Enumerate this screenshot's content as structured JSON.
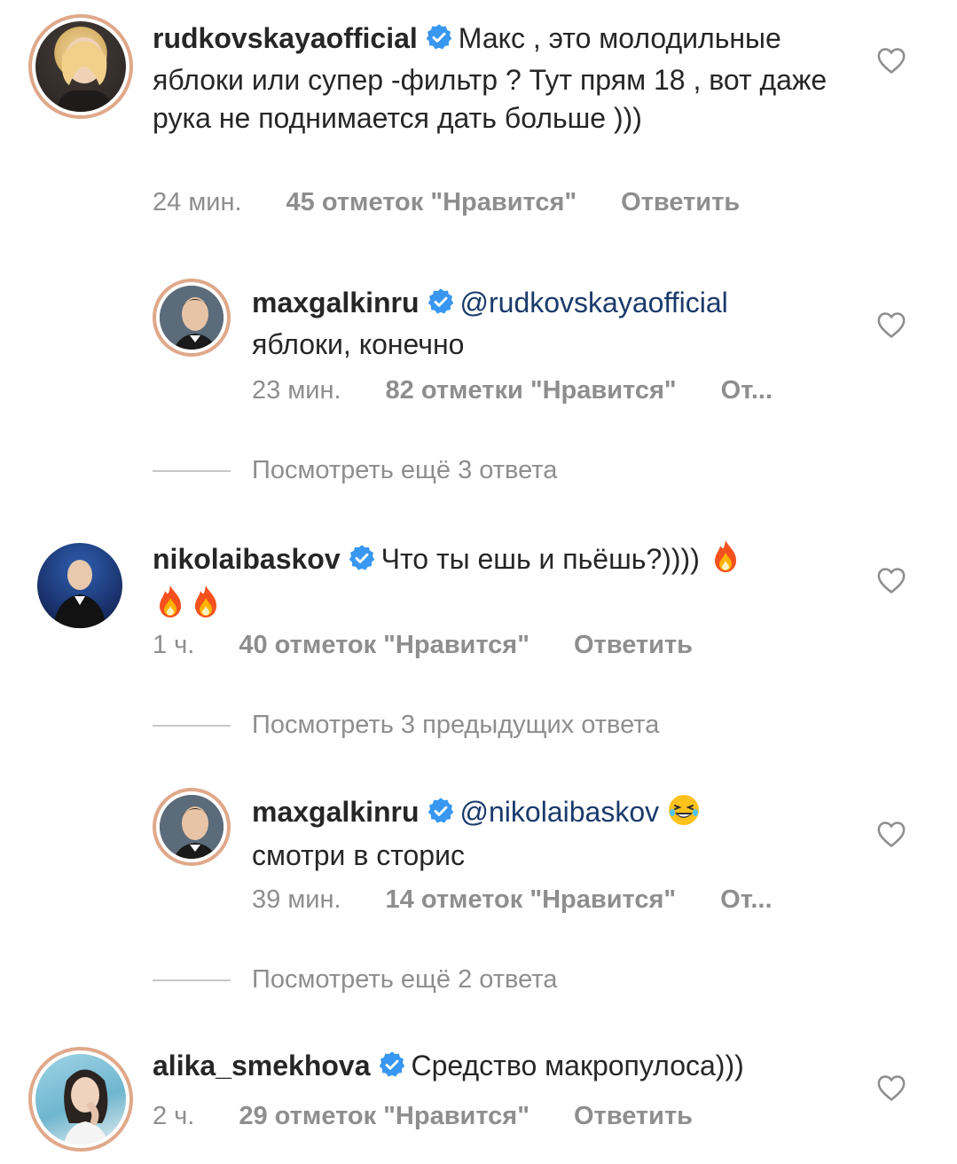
{
  "comments": [
    {
      "username": "rudkovskayaofficial",
      "text": "Макс , это молодильные яблоки или супер -фильтр ? Тут прям 18 , вот даже рука не поднимается дать больше )))",
      "time": "24 мин.",
      "likes": "45 отметок \"Нравится\"",
      "reply": "Ответить"
    },
    {
      "username": "maxgalkinru",
      "mention": "@rudkovskayaofficial",
      "text": "яблоки, конечно",
      "time": "23 мин.",
      "likes": "82 отметки \"Нравится\"",
      "reply": "От..."
    },
    {
      "username": "nikolaibaskov",
      "text": "Что ты ешь и пьёшь?))))",
      "time": "1 ч.",
      "likes": "40 отметок \"Нравится\"",
      "reply": "Ответить"
    },
    {
      "username": "maxgalkinru",
      "mention": "@nikolaibaskov",
      "text": "смотри в сторис",
      "time": "39 мин.",
      "likes": "14 отметок \"Нравится\"",
      "reply": "От..."
    },
    {
      "username": "alika_smekhova",
      "text": "Средство макропулоса)))",
      "time": "2 ч.",
      "likes": "29 отметок \"Нравится\"",
      "reply": "Ответить"
    }
  ],
  "thread_links": {
    "more_replies_1": "Посмотреть ещё 3 ответа",
    "previous_replies": "Посмотреть 3 предыдущих ответа",
    "more_replies_2": "Посмотреть ещё 2 ответа"
  },
  "colors": {
    "verified": "#3897f0",
    "muted": "#8e8e8e",
    "text": "#262626",
    "mention": "#1a3a6b",
    "story_ring": "#e0a88a"
  },
  "icons": [
    "verified-badge-icon",
    "heart-icon",
    "fire-emoji-icon",
    "laughing-emoji-icon"
  ]
}
